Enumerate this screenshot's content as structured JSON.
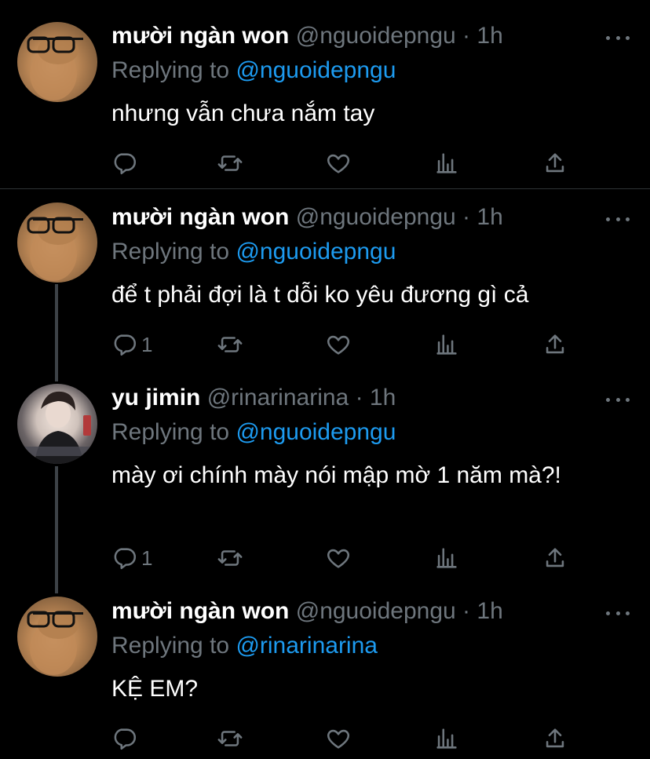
{
  "tweets": [
    {
      "name": "mười ngàn won",
      "handle": "@nguoidepngu",
      "sep": "·",
      "time": "1h",
      "replying_prefix": "Replying to",
      "replying_to": "@nguoidepngu",
      "text": "nhưng vẫn chưa nắm tay",
      "reply_count": "",
      "avatar": "cat-with-glasses"
    },
    {
      "name": "mười ngàn won",
      "handle": "@nguoidepngu",
      "sep": "·",
      "time": "1h",
      "replying_prefix": "Replying to",
      "replying_to": "@nguoidepngu",
      "text": "để t phải đợi là t dỗi ko yêu đương gì cả",
      "reply_count": "1",
      "avatar": "cat-with-glasses"
    },
    {
      "name": "yu jimin",
      "handle": "@rinarinarina",
      "sep": "·",
      "time": "1h",
      "replying_prefix": "Replying to",
      "replying_to": "@nguoidepngu",
      "text": "mày ơi chính mày nói mập mờ 1 năm mà?!",
      "reply_count": "1",
      "avatar": "person-photo"
    },
    {
      "name": "mười ngàn won",
      "handle": "@nguoidepngu",
      "sep": "·",
      "time": "1h",
      "replying_prefix": "Replying to",
      "replying_to": "@rinarinarina",
      "text": "KỆ EM?",
      "reply_count": "",
      "avatar": "cat-with-glasses"
    }
  ],
  "icons": {
    "reply": "reply-icon",
    "retweet": "retweet-icon",
    "like": "like-icon",
    "analytics": "analytics-icon",
    "share": "share-icon",
    "more": "more-icon"
  },
  "colors": {
    "background": "#000000",
    "primary_text": "#ffffff",
    "secondary_text": "#6e767d",
    "mention": "#1d9bf0",
    "divider": "#2f3336"
  }
}
